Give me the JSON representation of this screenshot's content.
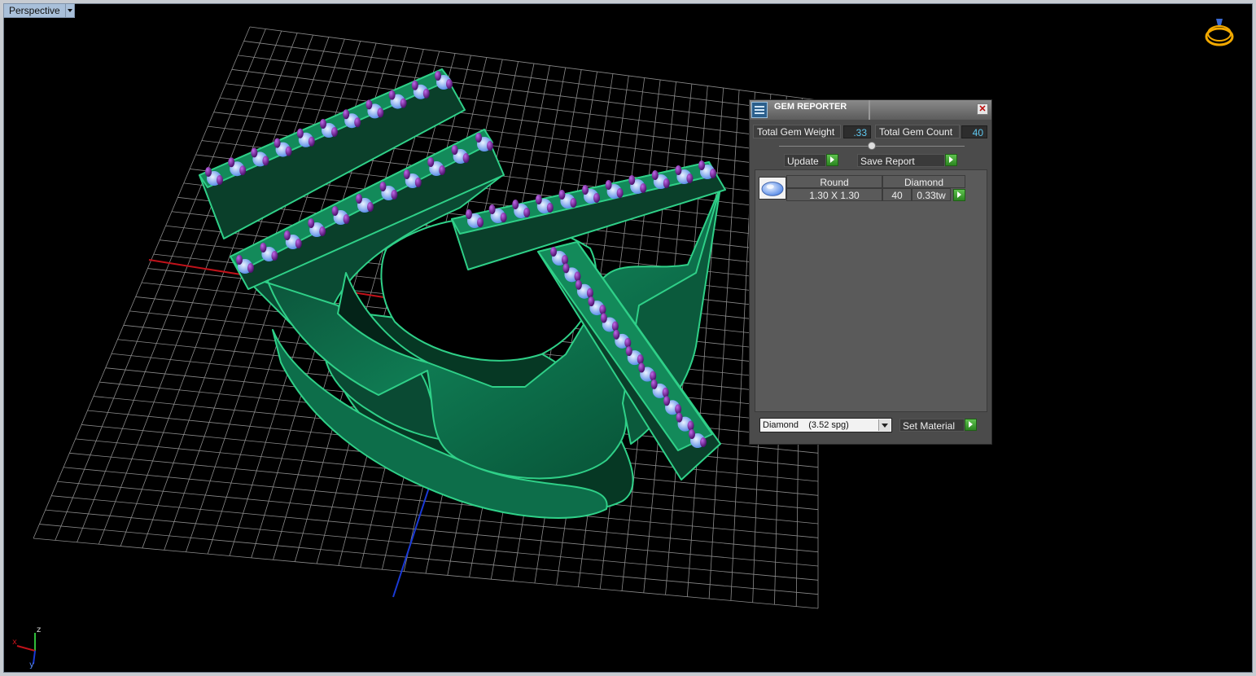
{
  "viewport": {
    "label": "Perspective"
  },
  "axis_gizmo": {
    "x_label": "x",
    "y_label": "y",
    "z_label": "z"
  },
  "icons": {
    "orientation": "ring-orientation-icon",
    "gem_reporter": "gem-reporter-icon",
    "close": "close-icon"
  },
  "gem_reporter": {
    "title": "GEM REPORTER",
    "total_weight_label": "Total Gem Weight",
    "total_weight_value": ".33",
    "total_count_label": "Total Gem Count",
    "total_count_value": "40",
    "update_label": "Update",
    "save_report_label": "Save Report",
    "table": {
      "header_shape": "Round",
      "header_material": "Diamond",
      "size": "1.30 X 1.30",
      "count": "40",
      "weight": "0.33tw"
    },
    "material_select": "Diamond    (3.52 spg)",
    "set_material_label": "Set Material"
  },
  "colors": {
    "viewport_bg": "#000000",
    "model_green": "#0c5e40",
    "model_edge": "#2fd088",
    "gem_blue": "#8ab8ff",
    "prong_purple": "#6a1b8c",
    "x_axis": "#c0121a",
    "z_axis": "#1a3ad6"
  }
}
